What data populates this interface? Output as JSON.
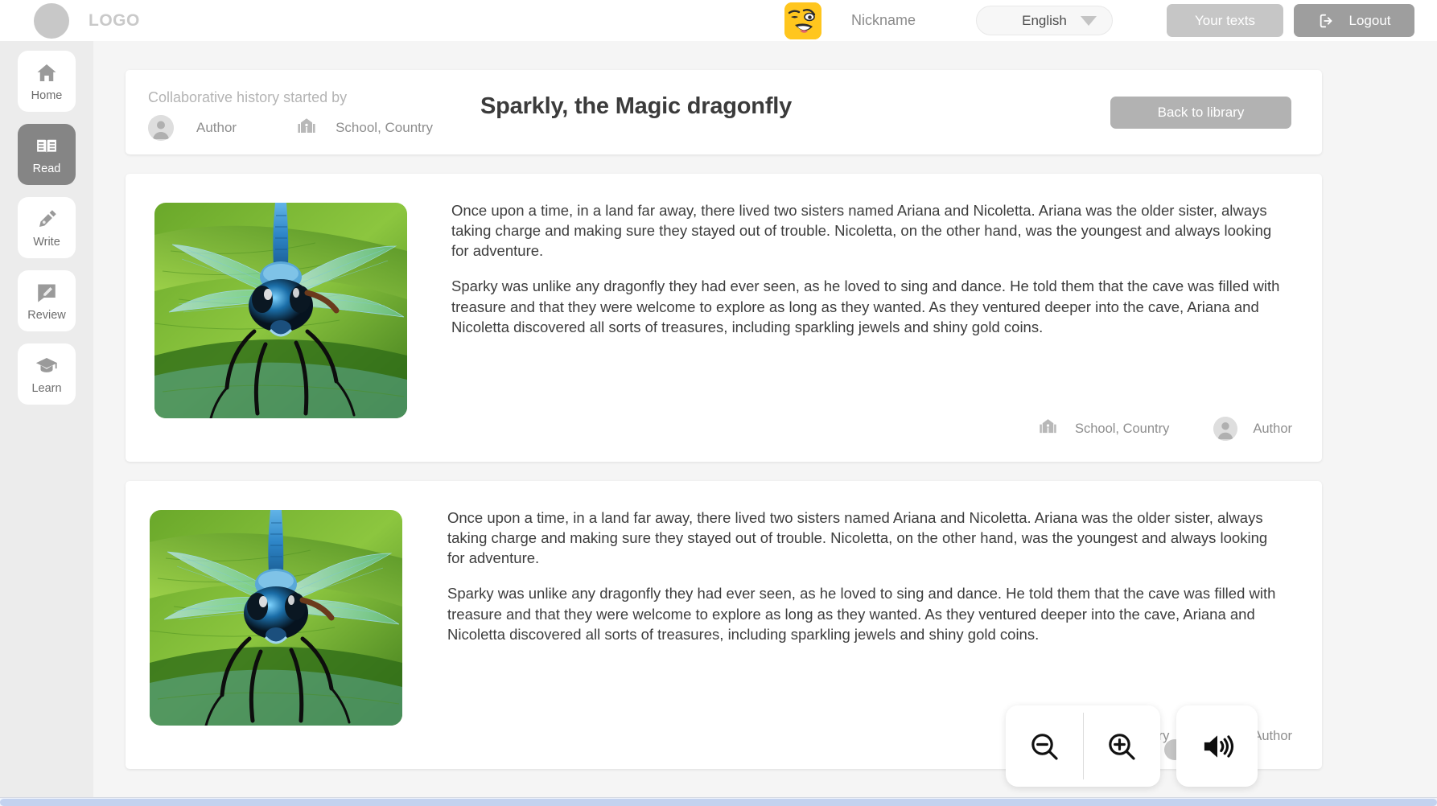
{
  "topbar": {
    "logo_text": "LOGO",
    "nickname": "Nickname",
    "language": "English",
    "your_texts_label": "Your texts",
    "logout_label": "Logout"
  },
  "sidebar": {
    "items": [
      {
        "label": "Home",
        "icon": "home-icon",
        "active": false
      },
      {
        "label": "Read",
        "icon": "book-icon",
        "active": true
      },
      {
        "label": "Write",
        "icon": "pen-icon",
        "active": false
      },
      {
        "label": "Review",
        "icon": "comment-edit-icon",
        "active": false
      },
      {
        "label": "Learn",
        "icon": "graduation-icon",
        "active": false
      }
    ]
  },
  "header_card": {
    "collab_label": "Collaborative history started by",
    "author": "Author",
    "school": "School, Country",
    "title": "Sparkly, the Magic dragonfly",
    "back_button": "Back to library"
  },
  "stories": [
    {
      "image_alt": "blue dragonfly resting on green leaves",
      "paragraphs": [
        "Once upon a time, in a land far away, there lived two sisters named Ariana and Nicoletta. Ariana was the older sister, always taking charge and making sure they stayed out of trouble. Nicoletta, on the other hand, was the youngest and always looking for adventure.",
        "Sparky was unlike any dragonfly they had ever seen, as he loved to sing and dance. He told them that the cave was filled with treasure and that they were welcome to explore as long as they wanted. As they ventured deeper into the cave, Ariana and Nicoletta discovered all sorts of treasures, including sparkling jewels and shiny gold coins."
      ],
      "school": "School, Country",
      "author": "Author"
    },
    {
      "image_alt": "blue dragonfly resting on green leaves",
      "paragraphs": [
        "Once upon a time, in a land far away, there lived two sisters named Ariana and Nicoletta. Ariana was the older sister, always taking charge and making sure they stayed out of trouble. Nicoletta, on the other hand, was the youngest and always looking for adventure.",
        "Sparky was unlike any dragonfly they had ever seen, as he loved to sing and dance. He told them that the cave was filled with treasure and that they were welcome to explore as long as they wanted. As they ventured deeper into the cave, Ariana and Nicoletta discovered all sorts of treasures, including sparkling jewels and shiny gold coins."
      ],
      "school": "School, Country",
      "author": "Author"
    }
  ],
  "toolbar": {
    "zoom_out_icon": "zoom-out-icon",
    "zoom_in_icon": "zoom-in-icon",
    "speaker_icon": "speaker-icon"
  },
  "colors": {
    "page_bg": "#f5f5f5",
    "sidebar_bg": "#ececec",
    "card_bg": "#ffffff",
    "active_nav": "#858585",
    "button_gray": "#b2b2b2",
    "logout_gray": "#9e9e9e",
    "avatar_yellow": "#ffc61e",
    "scrollbar": "#c3d2ef",
    "text_body": "#3d3d3d",
    "text_muted": "#8e8e8e"
  }
}
